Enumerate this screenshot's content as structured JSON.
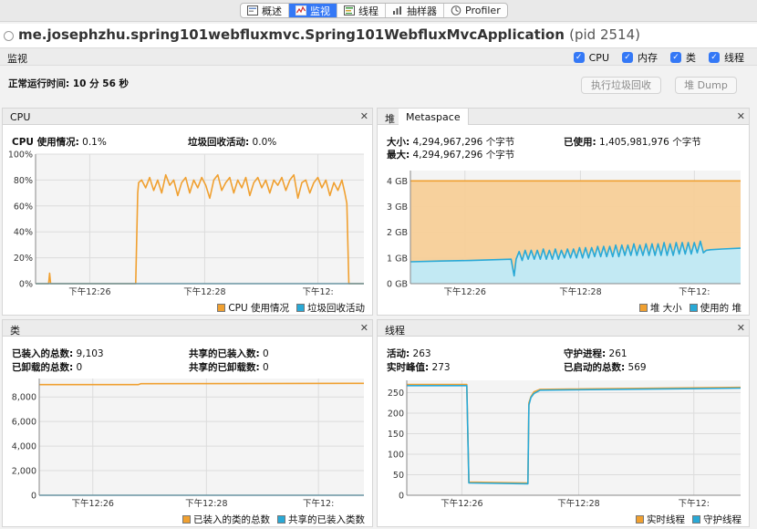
{
  "toolbar": {
    "tabs": [
      {
        "label": "概述",
        "icon": "overview-icon"
      },
      {
        "label": "监视",
        "icon": "monitor-icon"
      },
      {
        "label": "线程",
        "icon": "threads-icon"
      },
      {
        "label": "抽样器",
        "icon": "sampler-icon"
      },
      {
        "label": "Profiler",
        "icon": "profiler-icon"
      }
    ],
    "active": "监视"
  },
  "window": {
    "title": "me.josephzhu.spring101webfluxmvc.Spring101WebfluxMvcApplication",
    "pid": "(pid 2514)"
  },
  "monitor": {
    "section_label": "监视",
    "checkboxes": [
      {
        "label": "CPU",
        "checked": true
      },
      {
        "label": "内存",
        "checked": true
      },
      {
        "label": "类",
        "checked": true
      },
      {
        "label": "线程",
        "checked": true
      }
    ],
    "uptime": "正常运行时间:  10 分 56 秒",
    "gc_button": "执行垃圾回收",
    "heap_dump_button": "堆 Dump"
  },
  "cpu": {
    "title": "CPU",
    "usage_label": "CPU 使用情况:",
    "usage_value": "0.1%",
    "gc_label": "垃圾回收活动:",
    "gc_value": "0.0%"
  },
  "memory": {
    "tab_heap": "堆",
    "tab_metaspace": "Metaspace",
    "size_label": "大小:",
    "size_value": "4,294,967,296 个字节",
    "max_label": "最大:",
    "max_value": "4,294,967,296 个字节",
    "used_label": "已使用:",
    "used_value": "1,405,981,976 个字节"
  },
  "classes": {
    "title": "类",
    "loaded_label": "已装入的总数:",
    "loaded_value": "9,103",
    "unloaded_label": "已卸载的总数:",
    "unloaded_value": "0",
    "shared_loaded_label": "共享的已装入数:",
    "shared_loaded_value": "0",
    "shared_unloaded_label": "共享的已卸载数:",
    "shared_unloaded_value": "0"
  },
  "threads": {
    "title": "线程",
    "live_label": "活动:",
    "live_value": "263",
    "peak_label": "实时峰值:",
    "peak_value": "273",
    "daemon_label": "守护进程:",
    "daemon_value": "261",
    "started_label": "已启动的总数:",
    "started_value": "569"
  },
  "colors": {
    "orange": "#f0a030",
    "blue": "#29a9d6",
    "orange_fill": "#f7cf98",
    "blue_fill": "#bfeaf8",
    "accent": "#3478f6"
  },
  "chart_data": [
    {
      "type": "line",
      "name": "CPU",
      "x_ticks": [
        "下午12:26",
        "下午12:28",
        "下午12:"
      ],
      "y_ticks": [
        "0%",
        "20%",
        "40%",
        "60%",
        "80%",
        "100%"
      ],
      "ylim": [
        0,
        100
      ],
      "xlim": [
        0,
        656
      ],
      "series": [
        {
          "name": "CPU 使用情况",
          "color": "#f0a030",
          "points": [
            [
              0,
              0
            ],
            [
              26,
              0
            ],
            [
              28,
              8
            ],
            [
              30,
              0
            ],
            [
              200,
              0
            ],
            [
              204,
              70
            ],
            [
              206,
              78
            ],
            [
              212,
              80
            ],
            [
              220,
              74
            ],
            [
              228,
              82
            ],
            [
              236,
              72
            ],
            [
              244,
              80
            ],
            [
              252,
              70
            ],
            [
              260,
              84
            ],
            [
              268,
              76
            ],
            [
              276,
              80
            ],
            [
              284,
              68
            ],
            [
              292,
              78
            ],
            [
              300,
              82
            ],
            [
              308,
              70
            ],
            [
              316,
              80
            ],
            [
              324,
              74
            ],
            [
              332,
              82
            ],
            [
              340,
              76
            ],
            [
              348,
              66
            ],
            [
              356,
              80
            ],
            [
              364,
              84
            ],
            [
              372,
              72
            ],
            [
              380,
              78
            ],
            [
              388,
              82
            ],
            [
              396,
              70
            ],
            [
              404,
              80
            ],
            [
              412,
              74
            ],
            [
              420,
              82
            ],
            [
              428,
              68
            ],
            [
              436,
              78
            ],
            [
              444,
              82
            ],
            [
              452,
              74
            ],
            [
              460,
              80
            ],
            [
              468,
              70
            ],
            [
              476,
              80
            ],
            [
              484,
              76
            ],
            [
              492,
              82
            ],
            [
              500,
              72
            ],
            [
              508,
              80
            ],
            [
              516,
              84
            ],
            [
              524,
              66
            ],
            [
              532,
              78
            ],
            [
              540,
              80
            ],
            [
              548,
              70
            ],
            [
              556,
              78
            ],
            [
              564,
              82
            ],
            [
              572,
              74
            ],
            [
              580,
              80
            ],
            [
              588,
              68
            ],
            [
              596,
              78
            ],
            [
              604,
              72
            ],
            [
              612,
              80
            ],
            [
              618,
              70
            ],
            [
              622,
              62
            ],
            [
              626,
              0
            ],
            [
              656,
              0
            ]
          ]
        },
        {
          "name": "垃圾回收活动",
          "color": "#29a9d6",
          "points": [
            [
              0,
              0
            ],
            [
              656,
              0
            ]
          ]
        }
      ]
    },
    {
      "type": "area",
      "name": "Heap",
      "x_ticks": [
        "下午12:26",
        "下午12:28",
        "下午12:"
      ],
      "y_ticks": [
        "0 GB",
        "1 GB",
        "2 GB",
        "3 GB",
        "4 GB"
      ],
      "ylim": [
        0,
        4.4
      ],
      "xlim": [
        0,
        656
      ],
      "series": [
        {
          "name": "堆 大小",
          "color": "#f0a030",
          "points": [
            [
              0,
              4.0
            ],
            [
              656,
              4.0
            ]
          ]
        },
        {
          "name": "使用的 堆",
          "color": "#29a9d6",
          "points": [
            [
              0,
              0.85
            ],
            [
              60,
              0.88
            ],
            [
              120,
              0.9
            ],
            [
              200,
              0.95
            ],
            [
              206,
              0.3
            ],
            [
              210,
              0.95
            ],
            [
              216,
              1.25
            ],
            [
              222,
              0.9
            ],
            [
              228,
              1.3
            ],
            [
              234,
              0.95
            ],
            [
              240,
              1.3
            ],
            [
              246,
              0.95
            ],
            [
              252,
              1.3
            ],
            [
              258,
              0.95
            ],
            [
              264,
              1.35
            ],
            [
              270,
              0.95
            ],
            [
              276,
              1.3
            ],
            [
              282,
              0.95
            ],
            [
              288,
              1.35
            ],
            [
              294,
              0.95
            ],
            [
              300,
              1.3
            ],
            [
              306,
              1.0
            ],
            [
              312,
              1.35
            ],
            [
              318,
              1.0
            ],
            [
              324,
              1.35
            ],
            [
              330,
              1.0
            ],
            [
              336,
              1.4
            ],
            [
              342,
              1.0
            ],
            [
              348,
              1.4
            ],
            [
              354,
              1.0
            ],
            [
              360,
              1.4
            ],
            [
              366,
              1.05
            ],
            [
              372,
              1.45
            ],
            [
              378,
              1.05
            ],
            [
              384,
              1.45
            ],
            [
              390,
              1.05
            ],
            [
              396,
              1.45
            ],
            [
              402,
              1.05
            ],
            [
              408,
              1.5
            ],
            [
              414,
              1.05
            ],
            [
              420,
              1.5
            ],
            [
              426,
              1.1
            ],
            [
              432,
              1.5
            ],
            [
              438,
              1.1
            ],
            [
              444,
              1.55
            ],
            [
              450,
              1.1
            ],
            [
              456,
              1.5
            ],
            [
              462,
              1.1
            ],
            [
              468,
              1.55
            ],
            [
              474,
              1.1
            ],
            [
              480,
              1.55
            ],
            [
              486,
              1.1
            ],
            [
              492,
              1.55
            ],
            [
              498,
              1.1
            ],
            [
              504,
              1.6
            ],
            [
              510,
              1.1
            ],
            [
              516,
              1.55
            ],
            [
              522,
              1.1
            ],
            [
              528,
              1.6
            ],
            [
              534,
              1.15
            ],
            [
              540,
              1.6
            ],
            [
              546,
              1.15
            ],
            [
              552,
              1.6
            ],
            [
              558,
              1.15
            ],
            [
              564,
              1.6
            ],
            [
              570,
              1.2
            ],
            [
              576,
              1.65
            ],
            [
              582,
              1.2
            ],
            [
              588,
              1.3
            ],
            [
              596,
              1.32
            ],
            [
              620,
              1.35
            ],
            [
              656,
              1.38
            ]
          ]
        }
      ]
    },
    {
      "type": "line",
      "name": "Classes",
      "x_ticks": [
        "下午12:26",
        "下午12:28",
        "下午12:"
      ],
      "y_ticks": [
        "0",
        "2,000",
        "4,000",
        "6,000",
        "8,000"
      ],
      "ylim": [
        0,
        9500
      ],
      "xlim": [
        0,
        656
      ],
      "series": [
        {
          "name": "已装入的类的总数",
          "color": "#f0a030",
          "points": [
            [
              0,
              9000
            ],
            [
              200,
              9000
            ],
            [
              205,
              9080
            ],
            [
              656,
              9103
            ]
          ]
        },
        {
          "name": "共享的已装入类数",
          "color": "#29a9d6",
          "points": [
            [
              0,
              0
            ],
            [
              656,
              0
            ]
          ]
        }
      ]
    },
    {
      "type": "line",
      "name": "Threads",
      "x_ticks": [
        "下午12:26",
        "下午12:28",
        "下午12:"
      ],
      "y_ticks": [
        "0",
        "50",
        "100",
        "150",
        "200",
        "250"
      ],
      "ylim": [
        0,
        280
      ],
      "xlim": [
        0,
        656
      ],
      "series": [
        {
          "name": "实时线程",
          "color": "#f0a030",
          "points": [
            [
              0,
              270
            ],
            [
              118,
              270
            ],
            [
              122,
              32
            ],
            [
              238,
              30
            ],
            [
              240,
              225
            ],
            [
              244,
              240
            ],
            [
              250,
              252
            ],
            [
              262,
              258
            ],
            [
              656,
              263
            ]
          ]
        },
        {
          "name": "守护线程",
          "color": "#29a9d6",
          "points": [
            [
              0,
              267
            ],
            [
              118,
              267
            ],
            [
              122,
              30
            ],
            [
              238,
              28
            ],
            [
              240,
              220
            ],
            [
              244,
              238
            ],
            [
              250,
              248
            ],
            [
              262,
              256
            ],
            [
              656,
              261
            ]
          ]
        }
      ]
    }
  ]
}
